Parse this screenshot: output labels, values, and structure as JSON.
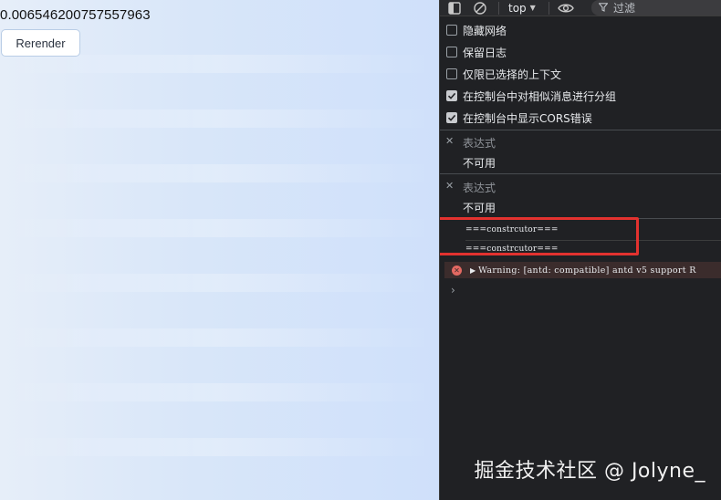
{
  "page": {
    "random_value": "0.006546200757557963",
    "rerender_label": "Rerender"
  },
  "devtools": {
    "toolbar": {
      "context_select": "top",
      "filter_placeholder": "过滤"
    },
    "settings": [
      {
        "label": "隐藏网络",
        "checked": false
      },
      {
        "label": "保留日志",
        "checked": false
      },
      {
        "label": "仅限已选择的上下文",
        "checked": false
      },
      {
        "label": "在控制台中对相似消息进行分组",
        "checked": true
      },
      {
        "label": "在控制台中显示CORS错误",
        "checked": true
      }
    ],
    "expressions": [
      {
        "label": "表达式",
        "value": "不可用"
      },
      {
        "label": "表达式",
        "value": "不可用"
      }
    ],
    "logs": [
      "===constrcutor===",
      "===constrcutor==="
    ],
    "warning": "Warning: [antd: compatible] antd v5 support R",
    "prompt": "›"
  },
  "watermark": "掘金技术社区 @ Jolyne_",
  "colors": {
    "devtools_bg": "#202124",
    "highlight": "#e3322f",
    "error_icon": "#e46962"
  }
}
